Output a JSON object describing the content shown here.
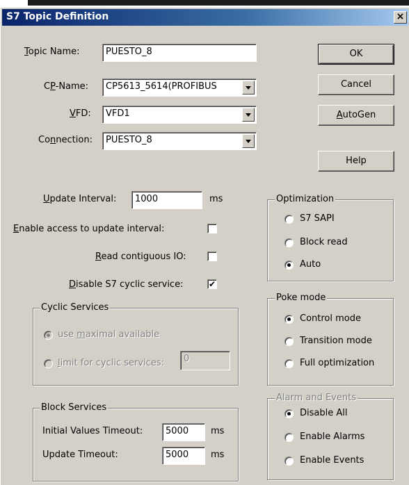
{
  "window": {
    "title": "S7 Topic Definition",
    "close_glyph": "×"
  },
  "topic": {
    "name_label_pre": "",
    "name_label_ul": "T",
    "name_label_post": "opic Name:",
    "name_value": "PUESTO_8",
    "cp_label_pre": "C",
    "cp_label_ul": "P",
    "cp_label_post": "-Name:",
    "cp_value": "CP5613_5614(PROFIBUS",
    "vfd_label_pre": "",
    "vfd_label_ul": "V",
    "vfd_label_post": "FD:",
    "vfd_value": "VFD1",
    "conn_label_pre": "Co",
    "conn_label_ul": "n",
    "conn_label_post": "nection:",
    "conn_value": "PUESTO_8"
  },
  "buttons": {
    "ok": "OK",
    "cancel": "Cancel",
    "autogen_ul": "A",
    "autogen_post": "utoGen",
    "help": "Help"
  },
  "settings": {
    "update_label_ul": "U",
    "update_label_post": "pdate Interval:",
    "update_value": "1000",
    "update_unit": "ms",
    "enable_access_ul": "E",
    "enable_access_post": "nable access to update interval:",
    "enable_access_checked": false,
    "read_contig_ul": "R",
    "read_contig_post": "ead contiguous IO:",
    "read_contig_checked": false,
    "disable_cyclic_ul": "D",
    "disable_cyclic_post": "isable S7 cyclic service:",
    "disable_cyclic_checked": true,
    "check_glyph": "✔"
  },
  "cyclic": {
    "title": "Cyclic Services",
    "opt1_pre": "use ",
    "opt1_ul": "m",
    "opt1_post": "aximal available",
    "opt2_ul": "l",
    "opt2_post": "imit for cyclic services:",
    "limit_value": "0"
  },
  "block": {
    "title": "Block Services",
    "initial_label": "Initial Values Timeout:",
    "initial_value": "5000",
    "initial_unit": "ms",
    "update_label": "Update Timeout:",
    "update_value": "5000",
    "update_unit": "ms"
  },
  "optimization": {
    "title": "Optimization",
    "options": [
      "S7 SAPI",
      "Block read",
      "Auto"
    ],
    "selected": "Auto"
  },
  "poke": {
    "title": "Poke mode",
    "options": [
      "Control mode",
      "Transition mode",
      "Full optimization"
    ],
    "selected": "Control mode"
  },
  "alarm": {
    "title": "Alarm and Events",
    "options": [
      "Disable All",
      "Enable Alarms",
      "Enable Events"
    ],
    "selected": "Disable All"
  }
}
